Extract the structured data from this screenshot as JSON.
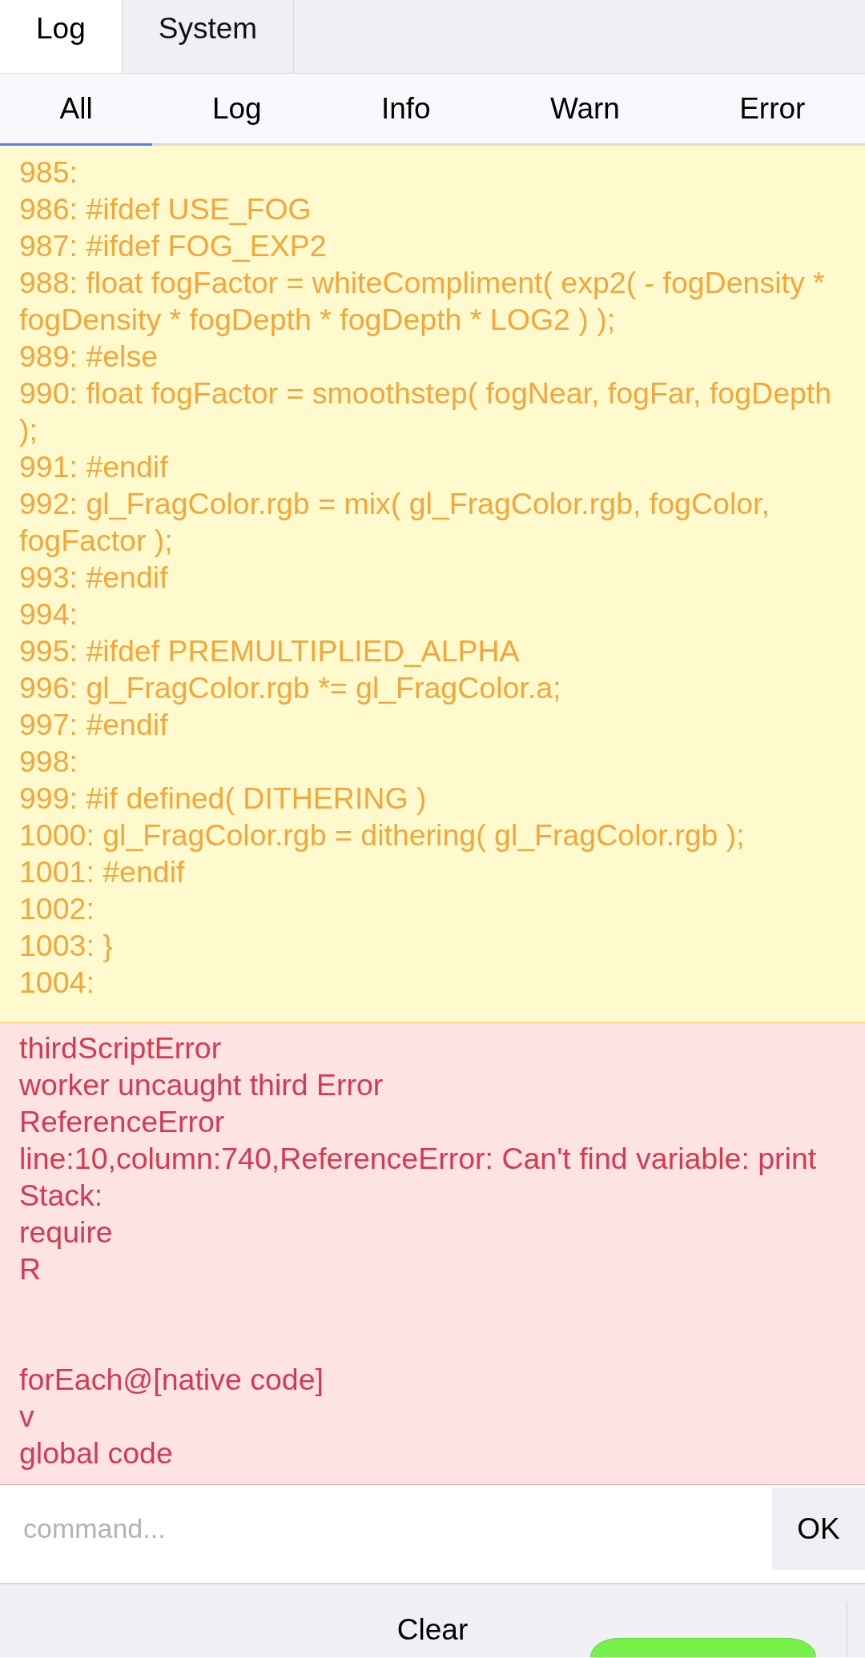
{
  "top_tabs": [
    {
      "label": "Log",
      "selected": true
    },
    {
      "label": "System",
      "selected": false
    }
  ],
  "filter_tabs": [
    {
      "label": "All",
      "selected": true
    },
    {
      "label": "Log",
      "selected": false
    },
    {
      "label": "Info",
      "selected": false
    },
    {
      "label": "Warn",
      "selected": false
    },
    {
      "label": "Error",
      "selected": false
    }
  ],
  "log_entries": [
    {
      "kind": "warn",
      "text": "985:\n986: #ifdef USE_FOG\n987: #ifdef FOG_EXP2\n988: float fogFactor = whiteCompliment( exp2( - fogDensity * fogDensity * fogDepth * fogDepth * LOG2 ) );\n989: #else\n990: float fogFactor = smoothstep( fogNear, fogFar, fogDepth );\n991: #endif\n992: gl_FragColor.rgb = mix( gl_FragColor.rgb, fogColor, fogFactor );\n993: #endif\n994:\n995: #ifdef PREMULTIPLIED_ALPHA\n996: gl_FragColor.rgb *= gl_FragColor.a;\n997: #endif\n998:\n999: #if defined( DITHERING )\n1000: gl_FragColor.rgb = dithering( gl_FragColor.rgb );\n1001: #endif\n1002:\n1003: }\n1004:"
    },
    {
      "kind": "error",
      "text": "thirdScriptError\nworker uncaught third Error\nReferenceError\nline:10,column:740,ReferenceError: Can't find variable: print\nStack:\nrequire\nR\n\n\nforEach@[native code]\nv\nglobal code"
    }
  ],
  "command_input": {
    "placeholder": "command..."
  },
  "ok_button": "OK",
  "clear_button": "Clear"
}
